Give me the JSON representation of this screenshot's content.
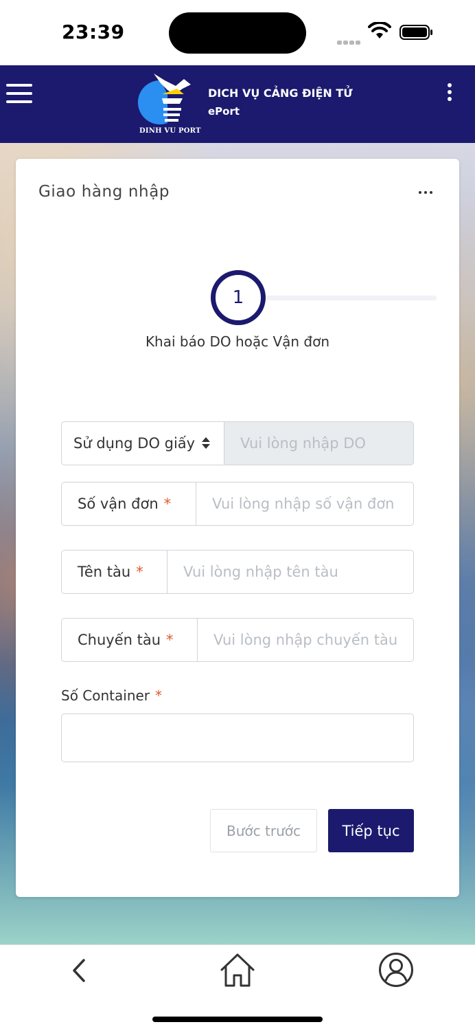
{
  "status_bar": {
    "time": "23:39"
  },
  "header": {
    "title": "DICH VỤ CẢNG ĐIỆN TỬ",
    "subtitle": "ePort",
    "logo_caption": "DINH VU PORT"
  },
  "card": {
    "title": "Giao hàng nhập",
    "step": {
      "number": "1",
      "label": "Khai báo DO hoặc Vận đơn"
    },
    "form": {
      "do_type": {
        "selected": "Sử dụng DO giấy",
        "placeholder": "Vui lòng nhập DO"
      },
      "bill_of_lading": {
        "label": "Số vận đơn",
        "required_mark": "*",
        "placeholder": "Vui lòng nhập số vận đơn"
      },
      "vessel_name": {
        "label": "Tên tàu",
        "required_mark": "*",
        "placeholder": "Vui lòng nhập tên tàu"
      },
      "voyage": {
        "label": "Chuyến tàu",
        "required_mark": "*",
        "placeholder": "Vui lòng nhập chuyến tàu"
      },
      "container": {
        "label": "Số Container",
        "required_mark": "*",
        "value": ""
      }
    },
    "buttons": {
      "prev_label": "Bước trước",
      "next_label": "Tiếp tục"
    }
  },
  "colors": {
    "brand": "#1b1a6e",
    "required": "#e05a2b",
    "disabled_bg": "#e9ecef"
  },
  "icons": [
    "menu-icon",
    "more-vertical-icon",
    "more-horizontal-icon",
    "back-icon",
    "home-icon",
    "user-icon",
    "wifi-icon",
    "battery-icon"
  ]
}
